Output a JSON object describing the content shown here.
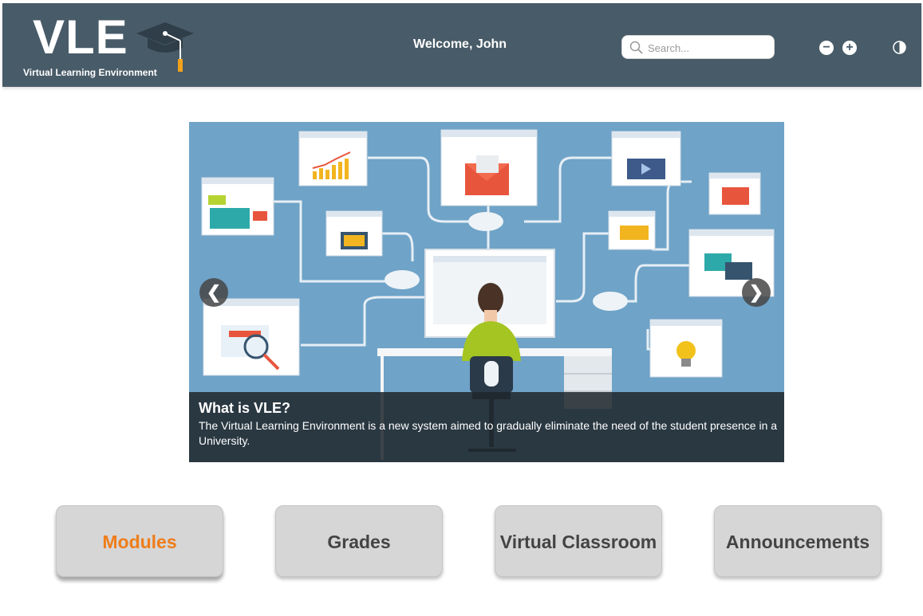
{
  "header": {
    "logo_text": "VLE",
    "logo_subtitle": "Virtual Learning Environment",
    "welcome": "Welcome, John",
    "search_placeholder": "Search...",
    "zoom_out_label": "−",
    "zoom_in_label": "+",
    "icons": {
      "logo": "graduation-cap-icon",
      "search": "search-icon",
      "zoom_out": "minus-circle-icon",
      "zoom_in": "plus-circle-icon",
      "contrast": "contrast-icon"
    },
    "colors": {
      "background": "#485b68",
      "tassel": "#f2a31b"
    }
  },
  "carousel": {
    "caption_title": "What is VLE?",
    "caption_text": "The Virtual Learning Environment is a new system aimed to gradually eliminate the need of the student presence in a University.",
    "prev_label": "❮",
    "next_label": "❯",
    "colors": {
      "background": "#6fa3c8",
      "caption": "#1e262c"
    }
  },
  "nav": {
    "modules": "Modules",
    "grades": "Grades",
    "virtual_classroom": "Virtual Classroom",
    "announcements": "Announcements",
    "active": "modules",
    "colors": {
      "active_text": "#ef7d1a",
      "text": "#444444",
      "button": "#d6d6d6"
    }
  }
}
